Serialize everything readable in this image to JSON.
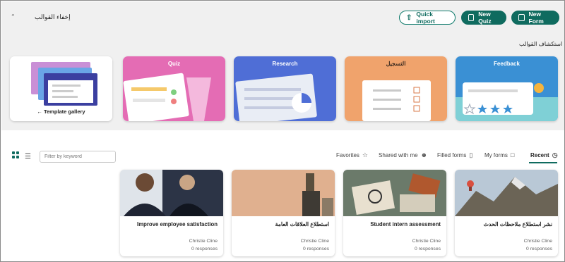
{
  "header": {
    "hide_label": "إخفاء القوالب",
    "quick_import": "Quick import",
    "new_quiz": "New Quiz",
    "new_form": "New Form",
    "explore_label": "استكشاف القوالب"
  },
  "templates": [
    {
      "label": "Feedback",
      "color": "#3a90d4"
    },
    {
      "label": "التسجيل",
      "color": "#f0a36c"
    },
    {
      "label": "Research",
      "color": "#4f6ed6"
    },
    {
      "label": "Quiz",
      "color": "#e46cb4"
    },
    {
      "label": "Template gallery"
    }
  ],
  "tabs": [
    {
      "label": "Recent",
      "icon": "clock-icon"
    },
    {
      "label": "My forms",
      "icon": "document-icon"
    },
    {
      "label": "Filled forms",
      "icon": "bookmark-icon"
    },
    {
      "label": "Shared with me",
      "icon": "people-icon"
    },
    {
      "label": "Favorites",
      "icon": "star-icon"
    }
  ],
  "filter_placeholder": "Filter by keyword",
  "forms": [
    {
      "title": "نشر استطلاع ملاحظات الحدث",
      "owner": "Christie Cline",
      "responses": "0 responses"
    },
    {
      "title": "Student intern assessment",
      "owner": "Christie Cline",
      "responses": "0 responses"
    },
    {
      "title": "استطلاع العلاقات العامة",
      "owner": "Christie Cline",
      "responses": "0 responses"
    },
    {
      "title": "Improve employee satisfaction",
      "owner": "Christie Cline",
      "responses": "0 responses"
    }
  ],
  "colors": {
    "accent": "#0f6b5f",
    "top_bg": "#f0f0f0"
  }
}
